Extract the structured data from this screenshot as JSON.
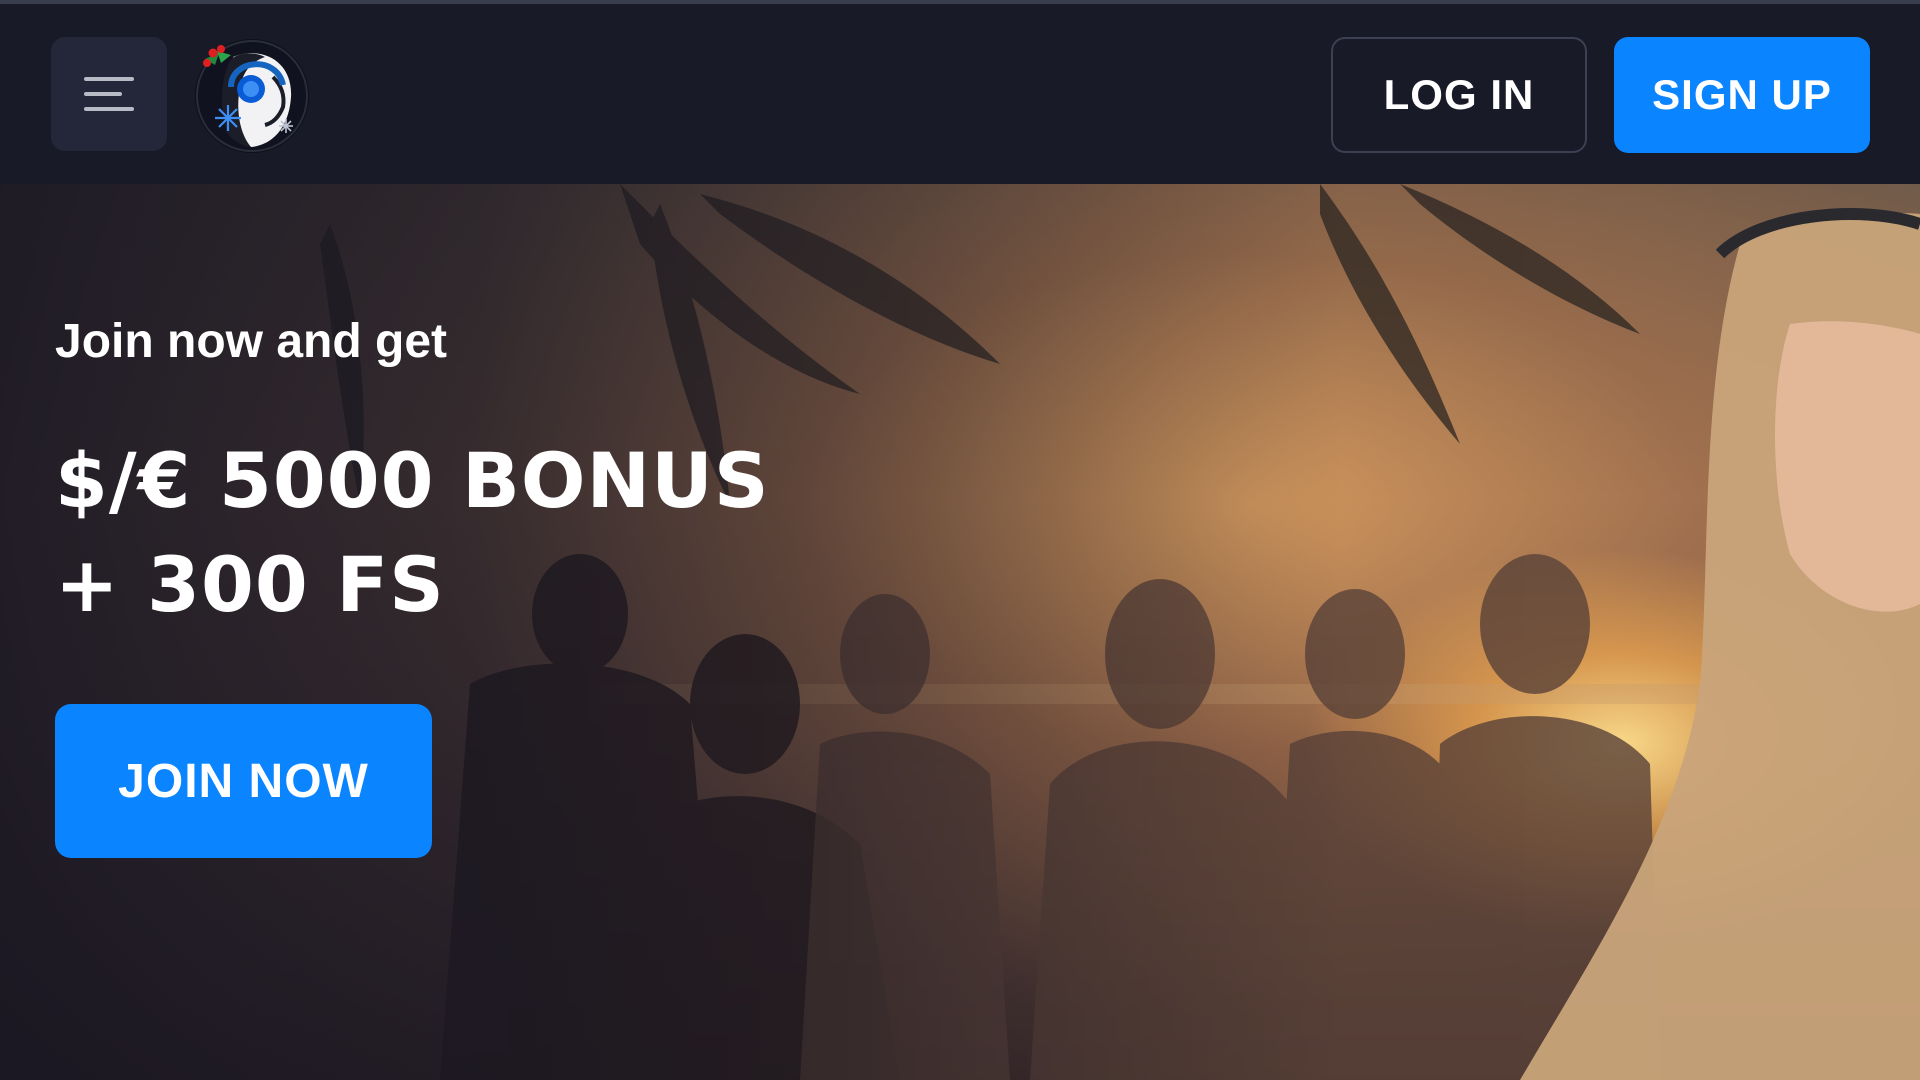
{
  "header": {
    "menu_icon": "hamburger-menu-icon",
    "logo_icon": "dj-girl-headphones-logo",
    "login_label": "LOG IN",
    "signup_label": "SIGN UP"
  },
  "hero": {
    "subtitle": "Join now and get",
    "title_line1": "$/€ 5000 BONUS",
    "title_line2": "+ 300 FS",
    "cta_label": "JOIN NOW"
  },
  "colors": {
    "background": "#181a27",
    "accent": "#0a84ff",
    "button_dark": "#24273a"
  }
}
